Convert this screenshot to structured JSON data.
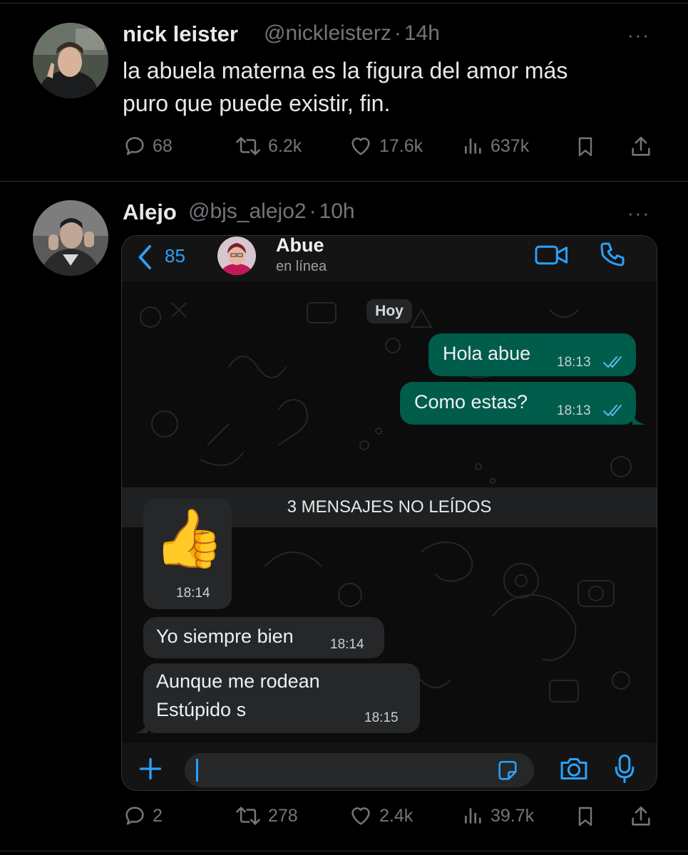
{
  "tweet1": {
    "name": "nick leister",
    "handle": "@nickleisterz",
    "sep": "·",
    "time": "14h",
    "text": "la abuela materna es la figura del amor más\npuro que puede existir, fin.",
    "replies": "68",
    "retweets": "6.2k",
    "likes": "17.6k",
    "views": "637k"
  },
  "tweet2": {
    "name": "Alejo",
    "handle": "@bjs_alejo2",
    "sep": "·",
    "time": "10h",
    "replies": "2",
    "retweets": "278",
    "likes": "2.4k",
    "views": "39.7k"
  },
  "more_label": "···",
  "chat": {
    "back_count": "85",
    "contact_name": "Abue",
    "contact_status": "en línea",
    "date_chip": "Hoy",
    "unread_banner": "3 MENSAJES NO LEÍDOS",
    "messages": [
      {
        "text": "Hola abue",
        "time": "18:13"
      },
      {
        "text": "Como estas?",
        "time": "18:13"
      },
      {
        "emoji": "👍",
        "time": "18:14"
      },
      {
        "text": "Yo siempre bien",
        "time": "18:14"
      },
      {
        "line1": "Aunque me rodean",
        "line2": "Estúpido s",
        "time": "18:15"
      }
    ]
  },
  "colors": {
    "background": "#000000",
    "outgoing_bubble": "#005c4b",
    "incoming_bubble": "#262729",
    "whatsapp_blue": "#2aa1ff",
    "muted": "#71767b"
  }
}
